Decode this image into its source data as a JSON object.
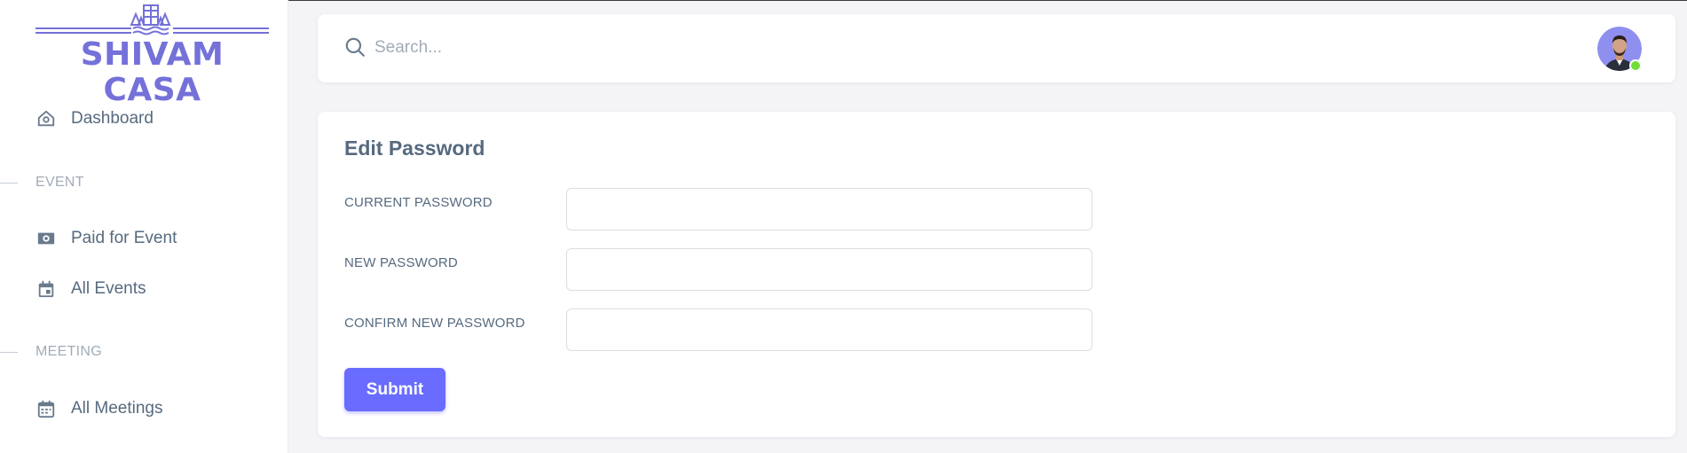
{
  "brand": {
    "name": "SHIVAM CASA",
    "color": "#7471d9",
    "logo_icon": "building-waves-logo"
  },
  "sidebar": {
    "items": [
      {
        "type": "link",
        "label": "Dashboard",
        "icon": "home-icon"
      },
      {
        "type": "header",
        "label": "EVENT"
      },
      {
        "type": "link",
        "label": "Paid for Event",
        "icon": "money-icon"
      },
      {
        "type": "link",
        "label": "All Events",
        "icon": "calendar-event-icon"
      },
      {
        "type": "header",
        "label": "MEETING"
      },
      {
        "type": "link",
        "label": "All Meetings",
        "icon": "calendar-icon"
      }
    ]
  },
  "navbar": {
    "search_placeholder": "Search...",
    "search_value": "",
    "user_status": "online",
    "status_color": "#71dd37"
  },
  "form": {
    "title": "Edit Password",
    "fields": [
      {
        "label": "CURRENT PASSWORD",
        "value": ""
      },
      {
        "label": "NEW PASSWORD",
        "value": ""
      },
      {
        "label": "CONFIRM NEW PASSWORD",
        "value": ""
      }
    ],
    "submit_label": "Submit",
    "accent_color": "#696cff"
  }
}
